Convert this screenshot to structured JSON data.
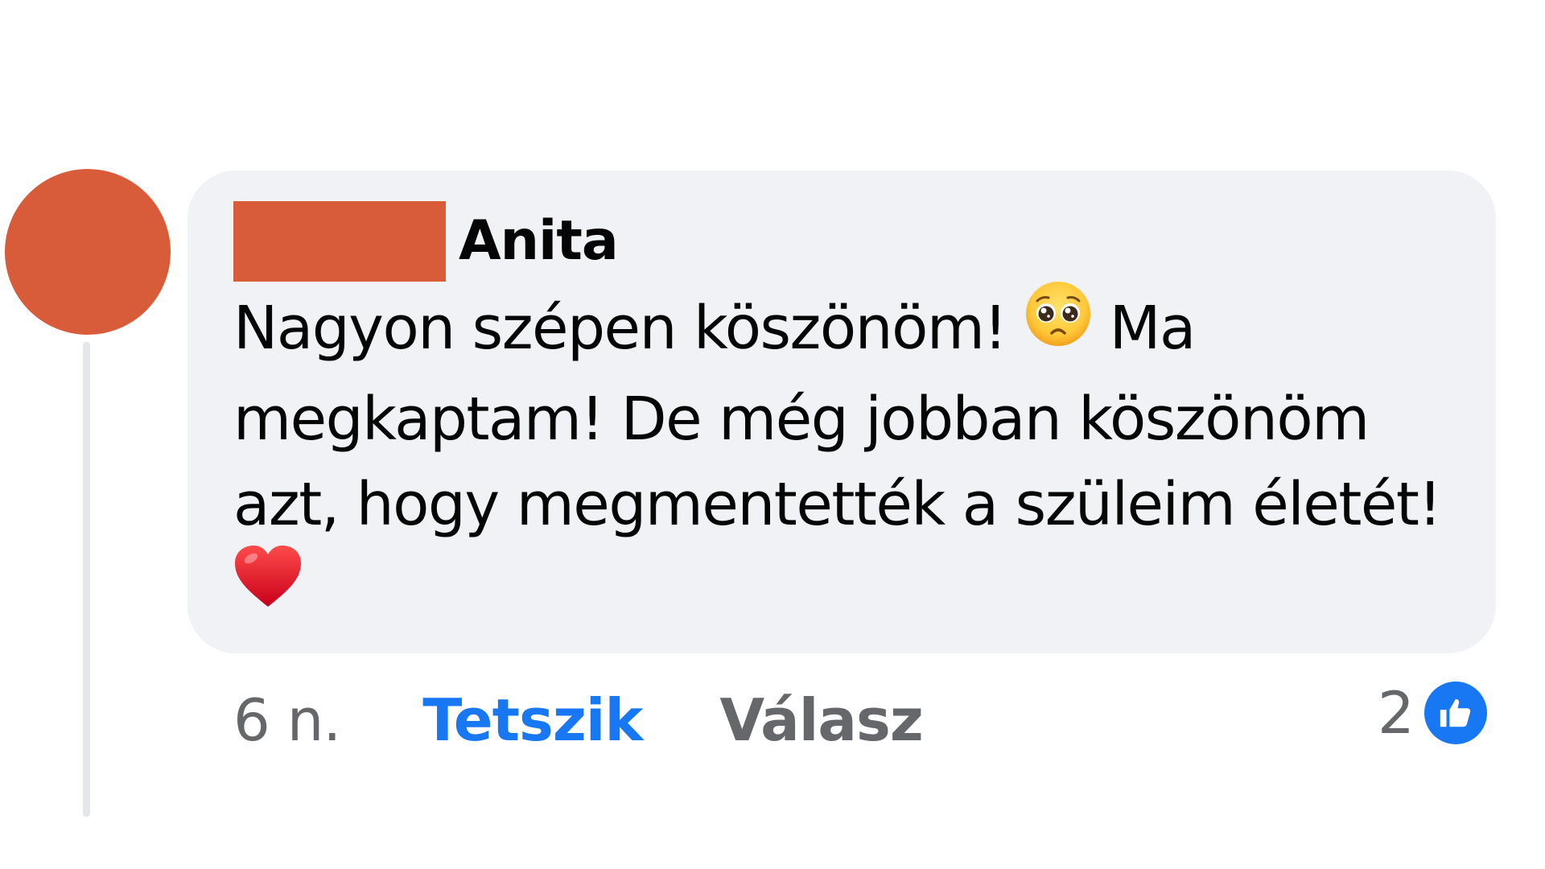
{
  "colors": {
    "redaction": "#d95c3a",
    "bubble_bg": "#f0f2f5",
    "thread_line": "#e4e6eb",
    "like_blue": "#1877f2",
    "muted_gray": "#65676b",
    "text": "#050505"
  },
  "comment": {
    "author_visible_name": "Anita",
    "text_before_emoji": "Nagyon szépen köszönöm! ",
    "text_middle": " Ma megkaptam! De még jobban köszönöm azt, hogy megmentették a szüleim életét! ",
    "emoji_1": "pleading-face-icon",
    "emoji_2": "red-heart-icon"
  },
  "actions": {
    "time": "6 n.",
    "like_label": "Tetszik",
    "reply_label": "Válasz"
  },
  "reactions": {
    "count": "2",
    "icon": "thumbs-up-icon"
  }
}
